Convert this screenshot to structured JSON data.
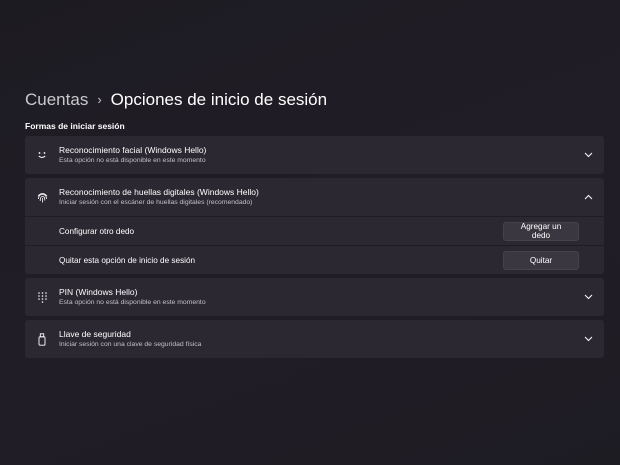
{
  "breadcrumb": {
    "parent": "Cuentas",
    "separator": "›",
    "current": "Opciones de inicio de sesión"
  },
  "section_title": "Formas de iniciar sesión",
  "cards": {
    "face": {
      "title": "Reconocimiento facial (Windows Hello)",
      "subtitle": "Esta opción no está disponible en este momento",
      "icon": "smile-face-icon",
      "expanded": false
    },
    "fingerprint": {
      "title": "Reconocimiento de huellas digitales (Windows Hello)",
      "subtitle": "Iniciar sesión con el escáner de huellas digitales (recomendado)",
      "icon": "fingerprint-icon",
      "expanded": true,
      "rows": {
        "add": {
          "label": "Configurar otro dedo",
          "button": "Agregar un dedo"
        },
        "remove": {
          "label": "Quitar esta opción de inicio de sesión",
          "button": "Quitar"
        }
      }
    },
    "pin": {
      "title": "PIN (Windows Hello)",
      "subtitle": "Esta opción no está disponible en este momento",
      "icon": "keypad-icon",
      "expanded": false
    },
    "key": {
      "title": "Llave de seguridad",
      "subtitle": "Iniciar sesión con una clave de seguridad física",
      "icon": "usb-key-icon",
      "expanded": false
    }
  },
  "colors": {
    "background": "#1e1c23",
    "card": "#2b2831",
    "button": "#3a3740"
  }
}
